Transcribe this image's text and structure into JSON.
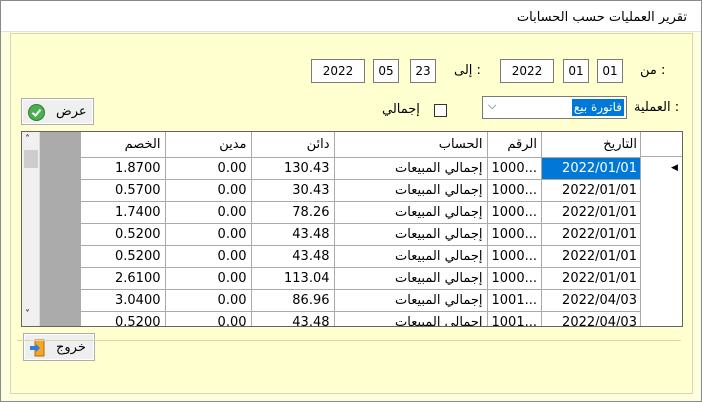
{
  "window": {
    "title": "تقرير العمليات حسب الحسابات"
  },
  "filters": {
    "from_label": "من :",
    "to_label": "إلى :",
    "from": {
      "day": "01",
      "month": "01",
      "year": "2022"
    },
    "to": {
      "day": "23",
      "month": "05",
      "year": "2022"
    },
    "operation_label": "العملية :",
    "operation_value": "فاتورة بيع",
    "total_label": "إجمالي",
    "total_checked": false
  },
  "buttons": {
    "show": "عرض",
    "exit": "خروج"
  },
  "grid": {
    "columns": [
      "التاريخ",
      "الرقم",
      "الحساب",
      "دائن",
      "مدين",
      "الخصم"
    ],
    "rows": [
      {
        "date": "2022/01/01",
        "number": "1000...",
        "account": "إجمالي المبيعات",
        "credit": "130.43",
        "debit": "0.00",
        "discount": "1.8700"
      },
      {
        "date": "2022/01/01",
        "number": "1000...",
        "account": "إجمالي المبيعات",
        "credit": "30.43",
        "debit": "0.00",
        "discount": "0.5700"
      },
      {
        "date": "2022/01/01",
        "number": "1000...",
        "account": "إجمالي المبيعات",
        "credit": "78.26",
        "debit": "0.00",
        "discount": "1.7400"
      },
      {
        "date": "2022/01/01",
        "number": "1000...",
        "account": "إجمالي المبيعات",
        "credit": "43.48",
        "debit": "0.00",
        "discount": "0.5200"
      },
      {
        "date": "2022/01/01",
        "number": "1000...",
        "account": "إجمالي المبيعات",
        "credit": "43.48",
        "debit": "0.00",
        "discount": "0.5200"
      },
      {
        "date": "2022/01/01",
        "number": "1000...",
        "account": "إجمالي المبيعات",
        "credit": "113.04",
        "debit": "0.00",
        "discount": "2.6100"
      },
      {
        "date": "2022/04/03",
        "number": "1001...",
        "account": "إجمالي المبيعات",
        "credit": "86.96",
        "debit": "0.00",
        "discount": "3.0400"
      },
      {
        "date": "2022/04/03",
        "number": "1001...",
        "account": "إجمالي المبيعات",
        "credit": "43.48",
        "debit": "0.00",
        "discount": "0.5200"
      }
    ]
  }
}
